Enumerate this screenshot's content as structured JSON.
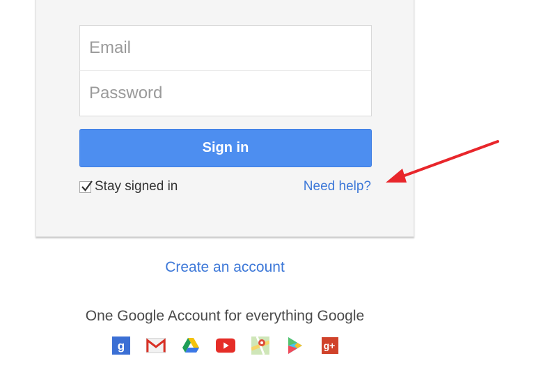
{
  "form": {
    "email_placeholder": "Email",
    "password_placeholder": "Password",
    "signin_label": "Sign in",
    "stay_signed_in_label": "Stay signed in",
    "stay_signed_in_checked": true,
    "need_help_label": "Need help?"
  },
  "links": {
    "create_account": "Create an account"
  },
  "footer": {
    "tagline": "One Google Account for everything Google",
    "apps": [
      {
        "name": "google-search-icon",
        "glyph": "g"
      },
      {
        "name": "gmail-icon",
        "glyph": "M"
      },
      {
        "name": "google-drive-icon",
        "glyph": ""
      },
      {
        "name": "youtube-icon",
        "glyph": ""
      },
      {
        "name": "google-maps-icon",
        "glyph": ""
      },
      {
        "name": "google-play-icon",
        "glyph": ""
      },
      {
        "name": "google-plus-icon",
        "glyph": "g+"
      }
    ]
  },
  "colors": {
    "accent_blue": "#4d8ef0",
    "link_blue": "#3d78d8",
    "annotation_red": "#e8262b"
  }
}
